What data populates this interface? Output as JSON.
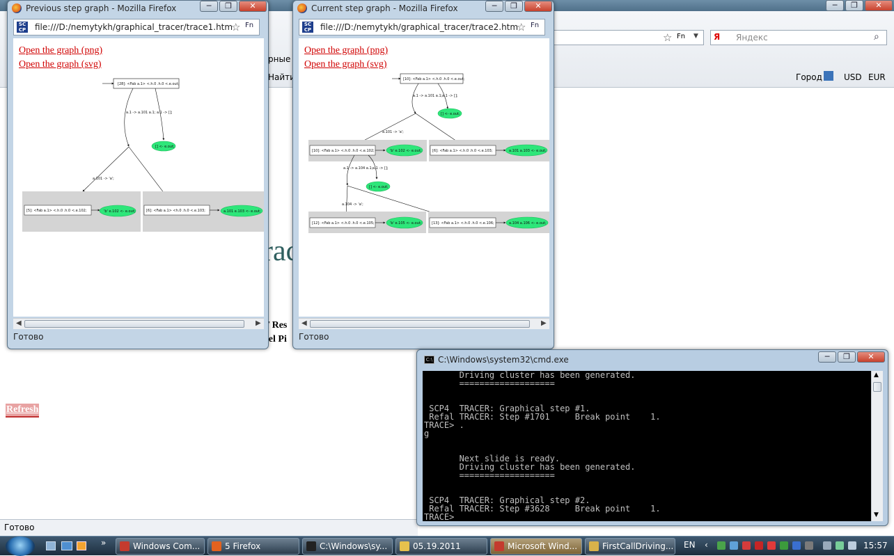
{
  "background_browser": {
    "search_placeholder": "Яндекс",
    "toolbar_text_1": "рные",
    "toolbar_text_2": "Найти",
    "city_label": "Город",
    "currency_usd": "USD",
    "currency_eur": "EUR",
    "page_fragment_large": "rac",
    "page_fragment_1": "T Res",
    "page_fragment_2": "uel Pi",
    "refresh_label": "Refresh",
    "status_text": "Готово"
  },
  "previous_window": {
    "title": "Previous step graph - Mozilla Firefox",
    "url": "file:///D:/nemytykh/graphical_tracer/trace1.htm",
    "link_png": "Open the graph (png)",
    "link_svg": "Open the graph (svg)",
    "status": "Готово",
    "graph": {
      "root": "[28]: <Fab a.1> <.h.0 .h.0 <.e.out;",
      "edge1": "a.1 -> a.101 a.1;",
      "edge2": "a.1 -> [];",
      "leaf1": "[] <- e.out;",
      "edge3": "a.101 -> 'a';",
      "node_a": "[5]: <Fab a.1> <.h.0 .h.0 <.e.102;",
      "leaf_a": "'b' e.102 <- e.out;",
      "node_b": "[6]: <Fab a.1> <h.0 .h.0 <.e.103;",
      "leaf_b": "a.101 e.103 <- e.out;"
    }
  },
  "current_window": {
    "title": "Current step graph - Mozilla Firefox",
    "url": "file:///D:/nemytykh/graphical_tracer/trace2.htm",
    "link_png": "Open the graph (png)",
    "link_svg": "Open the graph (svg)",
    "status": "Готово",
    "graph": {
      "root": "[10]: <Fab a.1> <.h.0 .h.0 <.e.out;",
      "edge1": "a.1 -> a.101 a.1;",
      "edge2": "a.1 -> [];",
      "leaf1": "[] <- e.out;",
      "edge3": "a.101 -> 'a';",
      "node_a": "[10]: <Fab a.1> <.h.0 .h.0 <.e.102;",
      "leaf_a": "'b' e.102 <- e.out;",
      "node_b": "[6]: <Fab a.1> <.h.0 .h.0 <.e.103;",
      "leaf_b": "a.101 a.103 <- e.out;",
      "edge4": "a.1 -> a.104 a.1;",
      "edge5": "a.1 -> [];",
      "leaf2": "[] <- e.out;",
      "edge6": "a.104 -> 'a';",
      "node_c": "[12]: <Fab a.1> <.h.0 .h.0 <.e.105;",
      "leaf_c": "'b' e.105 <- e.out;",
      "node_d": "[13]: <Fab a.1> <.h.0 .h.0 <.e.106;",
      "leaf_d": "a.104 a.106 <- e.out;"
    }
  },
  "cmd_window": {
    "title": "C:\\Windows\\system32\\cmd.exe",
    "lines": [
      "       Driving cluster has been generated.",
      "       ===================",
      "",
      "",
      " SCP4  TRACER: Graphical step #1.",
      " Refal TRACER: Step #1701     Break point    1.",
      "TRACE> .",
      "g",
      "",
      "",
      "       Next slide is ready.",
      "       Driving cluster has been generated.",
      "       ===================",
      "",
      "",
      " SCP4  TRACER: Graphical step #2.",
      " Refal TRACER: Step #3628     Break point    1.",
      "TRACE>"
    ]
  },
  "taskbar": {
    "items": [
      {
        "label": "Windows Com...",
        "color": "#c43b2e"
      },
      {
        "label": "5 Firefox",
        "color": "#e2621e"
      },
      {
        "label": "C:\\Windows\\sy...",
        "color": "#222222"
      },
      {
        "label": "05.19.2011",
        "color": "#e6c14d"
      },
      {
        "label": "Microsoft Wind...",
        "color": "#c43b2e"
      },
      {
        "label": "FirstCallDriving...",
        "color": "#d9b24a"
      }
    ],
    "language": "EN",
    "clock": "15:57"
  }
}
